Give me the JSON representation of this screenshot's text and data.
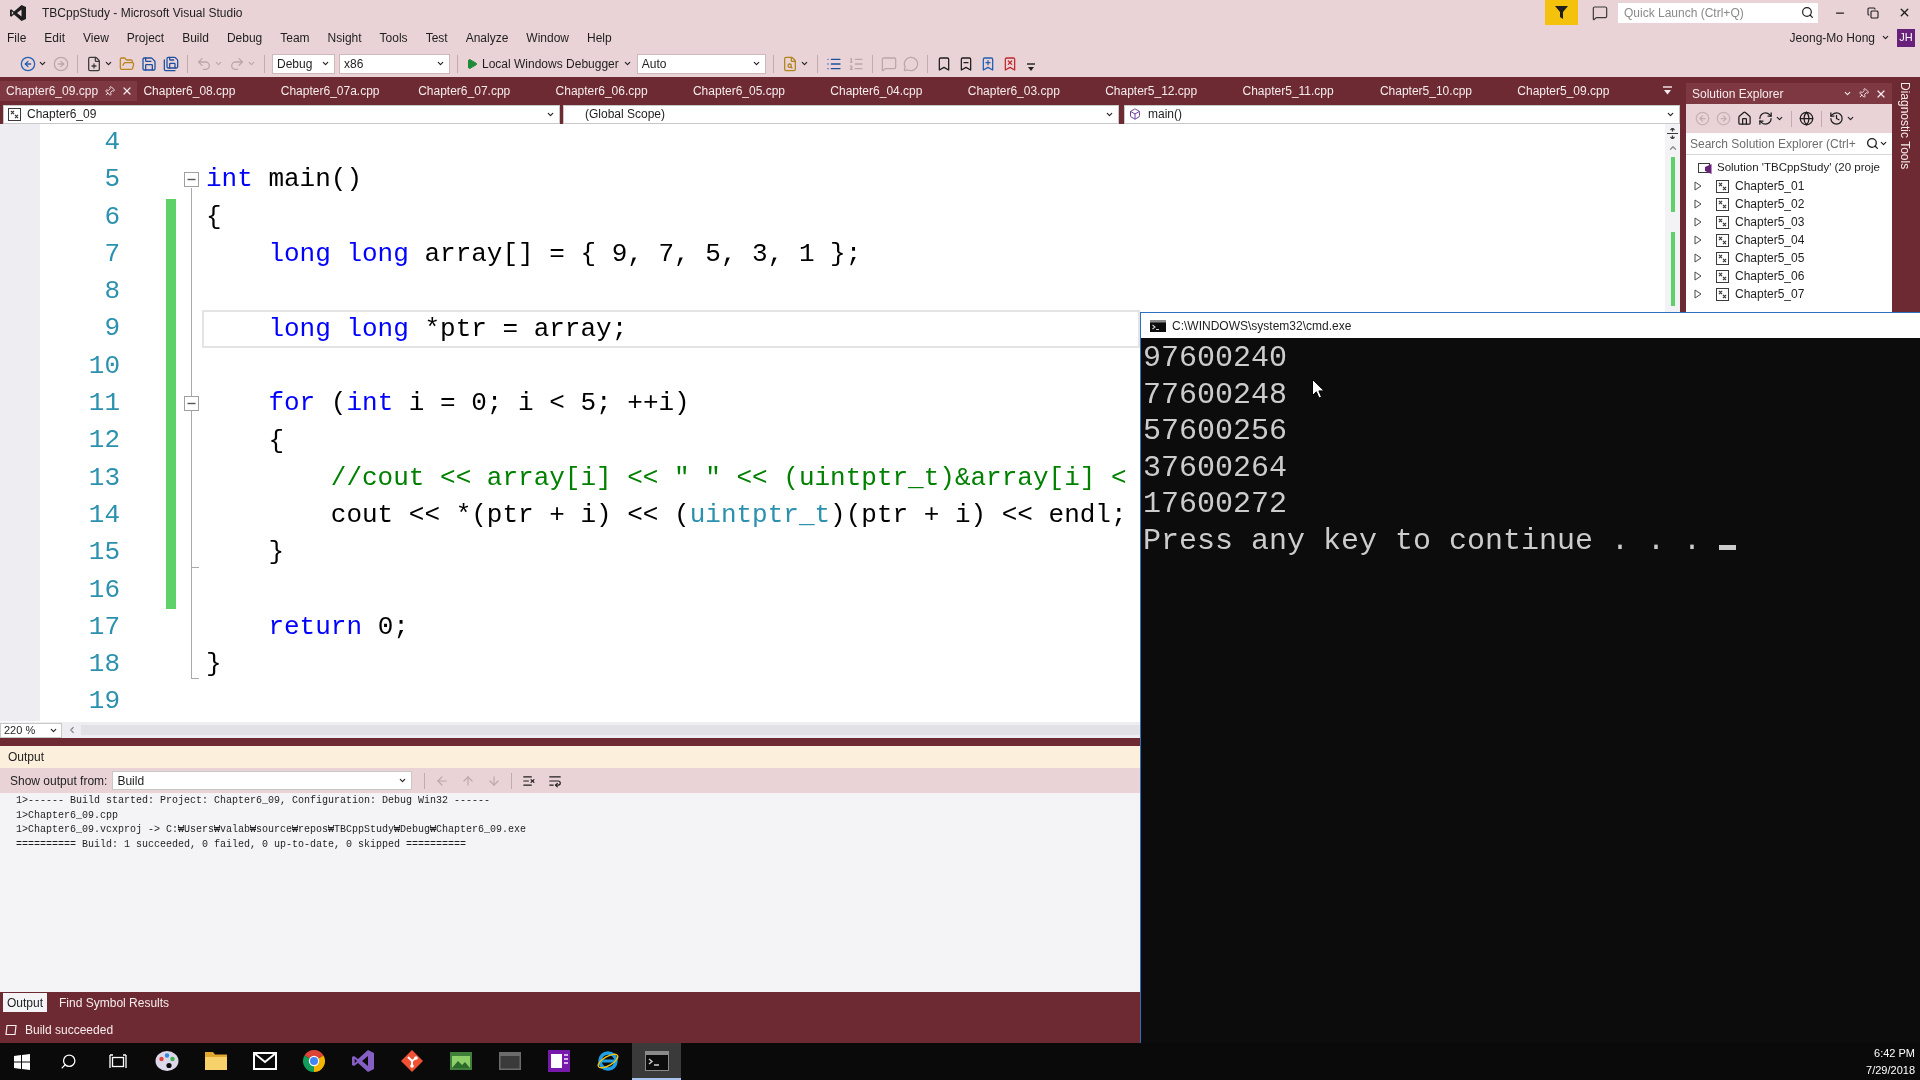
{
  "window": {
    "title": "TBCppStudy - Microsoft Visual Studio",
    "quick_launch": {
      "placeholder": "Quick Launch (Ctrl+Q)"
    },
    "user": {
      "name": "Jeong-Mo Hong",
      "initials": "JH"
    }
  },
  "menu": [
    "File",
    "Edit",
    "View",
    "Project",
    "Build",
    "Debug",
    "Team",
    "Nsight",
    "Tools",
    "Test",
    "Analyze",
    "Window",
    "Help"
  ],
  "toolbar": {
    "groups": [
      [
        {
          "kind": "icon",
          "disabled": false,
          "menu": true
        },
        {
          "kind": "icon",
          "disabled": true,
          "menu": false
        }
      ],
      [
        {
          "kind": "icon",
          "disabled": false,
          "menu": true
        },
        {
          "kind": "icon",
          "disabled": false,
          "menu": false
        },
        {
          "kind": "icon",
          "disabled": false,
          "menu": false
        },
        {
          "kind": "icon",
          "disabled": false,
          "menu": false
        }
      ],
      [
        {
          "kind": "icon",
          "disabled": true,
          "menu": true
        },
        {
          "kind": "icon",
          "disabled": true,
          "menu": true
        }
      ],
      [
        {
          "kind": "dropdown",
          "value": "Debug"
        },
        {
          "kind": "dropdown",
          "value": "x86"
        }
      ],
      [
        {
          "kind": "run",
          "label": "Local Windows Debugger"
        },
        {
          "kind": "dropdown",
          "value": "Auto"
        }
      ],
      [
        {
          "kind": "icon",
          "disabled": false,
          "menu": true
        }
      ],
      [
        {
          "kind": "icon",
          "disabled": false,
          "menu": false
        },
        {
          "kind": "icon",
          "disabled": true,
          "menu": false
        }
      ],
      [
        {
          "kind": "icon",
          "disabled": true,
          "menu": false
        },
        {
          "kind": "icon",
          "disabled": true,
          "menu": false
        }
      ],
      [
        {
          "kind": "icon",
          "disabled": false,
          "menu": false
        },
        {
          "kind": "icon",
          "disabled": false,
          "menu": false
        },
        {
          "kind": "icon",
          "disabled": false,
          "menu": false
        },
        {
          "kind": "icon",
          "disabled": false,
          "menu": false
        }
      ]
    ]
  },
  "editor": {
    "tabs": [
      {
        "label": "Chapter6_09.cpp",
        "selected": true
      },
      {
        "label": "Chapter6_08.cpp",
        "selected": false
      },
      {
        "label": "Chapter6_07a.cpp",
        "selected": false
      },
      {
        "label": "Chapter6_07.cpp",
        "selected": false
      },
      {
        "label": "Chapter6_06.cpp",
        "selected": false
      },
      {
        "label": "Chapter6_05.cpp",
        "selected": false
      },
      {
        "label": "Chapter6_04.cpp",
        "selected": false
      },
      {
        "label": "Chapter6_03.cpp",
        "selected": false
      },
      {
        "label": "Chapter5_12.cpp",
        "selected": false
      },
      {
        "label": "Chapter5_11.cpp",
        "selected": false
      },
      {
        "label": "Chapter5_10.cpp",
        "selected": false
      },
      {
        "label": "Chapter5_09.cpp",
        "selected": false
      }
    ],
    "navigation": {
      "project": "Chapter6_09",
      "scope": "(Global Scope)",
      "member": "main()"
    },
    "lines": [
      {
        "number": "4",
        "changed": false,
        "current": false
      },
      {
        "number": "5",
        "changed": false,
        "current": false,
        "tokens": [
          {
            "text": "int",
            "kind": "keyword"
          },
          {
            "text": " main()",
            "kind": "plain"
          }
        ],
        "expanded": true,
        "children": [
          {
            "number": "6",
            "changed": true,
            "current": false,
            "tokens": [
              {
                "text": "{",
                "kind": "plain"
              }
            ]
          },
          {
            "number": "7",
            "changed": true,
            "current": false,
            "tokens": [
              {
                "text": "    long long",
                "kind": "keyword"
              },
              {
                "text": " array[] = { 9, 7, 5, 3, 1 };",
                "kind": "plain"
              }
            ]
          },
          {
            "number": "8",
            "changed": true,
            "current": false
          },
          {
            "number": "9",
            "changed": true,
            "current": true,
            "tokens": [
              {
                "text": "    long long",
                "kind": "keyword"
              },
              {
                "text": " *ptr = array;",
                "kind": "plain"
              }
            ]
          },
          {
            "number": "10",
            "changed": true,
            "current": false
          },
          {
            "number": "11",
            "changed": true,
            "current": false,
            "tokens": [
              {
                "text": "    for",
                "kind": "keyword"
              },
              {
                "text": " (",
                "kind": "plain"
              },
              {
                "text": "int",
                "kind": "keyword"
              },
              {
                "text": " i = 0; i < 5; ++i)",
                "kind": "plain"
              }
            ],
            "expanded": true,
            "children": [
              {
                "number": "12",
                "changed": true,
                "current": false,
                "tokens": [
                  {
                    "text": "    {",
                    "kind": "plain"
                  }
                ]
              },
              {
                "number": "13",
                "changed": true,
                "current": false,
                "tokens": [
                  {
                    "text": "        //cout << array[i] << \" \" << (uintptr_t)&array[i] <",
                    "kind": "comment"
                  }
                ]
              },
              {
                "number": "14",
                "changed": true,
                "current": false,
                "tokens": [
                  {
                    "text": "        cout << *(ptr + i) << (",
                    "kind": "plain"
                  },
                  {
                    "text": "uintptr_t",
                    "kind": "type"
                  },
                  {
                    "text": ")(ptr + i) << endl;",
                    "kind": "plain"
                  }
                ]
              },
              {
                "number": "15",
                "changed": true,
                "current": false,
                "tokens": [
                  {
                    "text": "    }",
                    "kind": "plain"
                  }
                ]
              }
            ]
          },
          {
            "number": "16",
            "changed": true,
            "current": false
          },
          {
            "number": "17",
            "changed": false,
            "current": false,
            "tokens": [
              {
                "text": "    return",
                "kind": "keyword"
              },
              {
                "text": " 0;",
                "kind": "plain"
              }
            ]
          },
          {
            "number": "18",
            "changed": false,
            "current": false,
            "tokens": [
              {
                "text": "}",
                "kind": "plain"
              }
            ]
          }
        ]
      },
      {
        "number": "19",
        "changed": false,
        "current": false
      }
    ],
    "zoom": "220 %"
  },
  "solution_explorer": {
    "title": "Solution Explorer",
    "toolbar": [
      {
        "disabled": true,
        "menu": false
      },
      {
        "disabled": true,
        "menu": false
      },
      {
        "disabled": false,
        "menu": false
      },
      {
        "disabled": false,
        "menu": true
      },
      {
        "disabled": false,
        "menu": false
      },
      {
        "disabled": false,
        "menu": true
      }
    ],
    "search": {
      "placeholder": "Search Solution Explorer (Ctrl+"
    },
    "tree": {
      "label": "Solution 'TBCppStudy' (20 proje",
      "children": [
        {
          "label": "Chapter5_01",
          "expanded": false
        },
        {
          "label": "Chapter5_02",
          "expanded": false
        },
        {
          "label": "Chapter5_03",
          "expanded": false
        },
        {
          "label": "Chapter5_04",
          "expanded": false
        },
        {
          "label": "Chapter5_05",
          "expanded": false
        },
        {
          "label": "Chapter5_06",
          "expanded": false
        },
        {
          "label": "Chapter5_07",
          "expanded": false
        }
      ]
    }
  },
  "side_tabs": [
    {
      "label": "Diagnostic Tools"
    }
  ],
  "output": {
    "title": "Output",
    "source_label": "Show output from:",
    "source": "Build",
    "toolbar": [
      {
        "disabled": true
      },
      {
        "disabled": true
      },
      {
        "disabled": true
      },
      {
        "disabled": false
      },
      {
        "disabled": false
      }
    ],
    "lines": [
      "1>------ Build started: Project: Chapter6_09, Configuration: Debug Win32 ------",
      "1>Chapter6_09.cpp",
      "1>Chapter6_09.vcxproj -> C:₩Users₩valab₩source₩repos₩TBCppStudy₩Debug₩Chapter6_09.exe",
      "========== Build: 1 succeeded, 0 failed, 0 up-to-date, 0 skipped =========="
    ],
    "tabs": [
      {
        "label": "Output",
        "selected": true
      },
      {
        "label": "Find Symbol Results",
        "selected": false
      }
    ]
  },
  "status_bar": {
    "text": "Build succeeded"
  },
  "console": {
    "title": "C:\\WINDOWS\\system32\\cmd.exe",
    "lines": [
      "97600240",
      "77600248",
      "57600256",
      "37600264",
      "17600272",
      "Press any key to continue . . ."
    ]
  },
  "taskbar": {
    "apps": [
      {
        "selected": false
      },
      {
        "selected": false
      },
      {
        "selected": false
      },
      {
        "selected": false
      },
      {
        "selected": false
      },
      {
        "selected": false
      },
      {
        "selected": false
      },
      {
        "selected": false
      },
      {
        "selected": false
      },
      {
        "selected": false
      },
      {
        "selected": true
      }
    ],
    "clock": {
      "time": "6:42 PM",
      "date": "7/29/2018"
    }
  }
}
